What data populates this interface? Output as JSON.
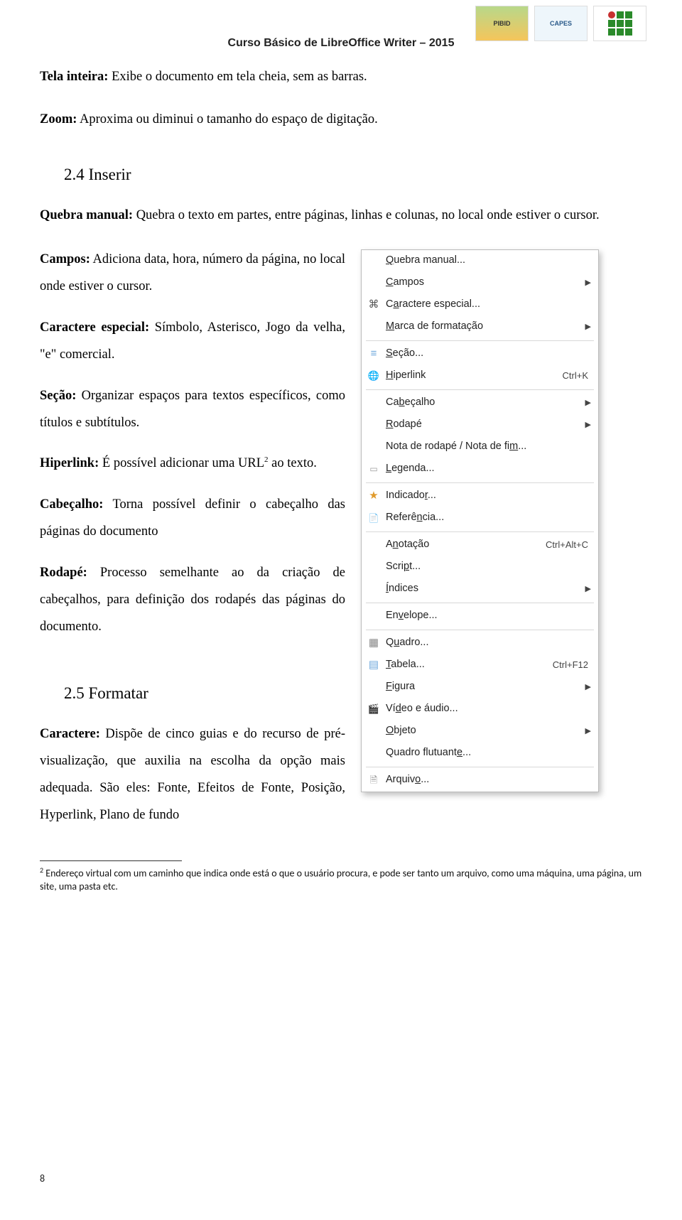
{
  "header": {
    "course_title": "Curso Básico de LibreOffice Writer – 2015",
    "logos": {
      "pibid": "PIBID",
      "capes": "CAPES",
      "if": "IFRN"
    }
  },
  "body": {
    "tela_label": "Tela inteira:",
    "tela_text": " Exibe o documento em tela cheia, sem as barras.",
    "zoom_label": "Zoom:",
    "zoom_text": " Aproxima ou diminui o tamanho do espaço de digitação.",
    "sec24_heading": "2.4 Inserir",
    "quebra_label": "Quebra manual:",
    "quebra_text_1": " Quebra o texto em partes, entre páginas, linhas e colunas, no local onde estiver o cursor.",
    "campos_label": "Campos:",
    "campos_text": " Adiciona data, hora, número da página, no local onde estiver o cursor.",
    "caractere_esp_label": "Caractere especial:",
    "caractere_esp_text": " Símbolo, Asterisco, Jogo da velha, \"e\" comercial.",
    "secao_label": "Seção:",
    "secao_text": " Organizar espaços para textos específicos, como títulos e subtítulos.",
    "hiperlink_label": "Hiperlink:",
    "hiperlink_text_pre": " É possível adicionar uma URL",
    "hiperlink_sup": "2",
    "hiperlink_text_post": " ao texto.",
    "cabecalho_label": "Cabeçalho:",
    "cabecalho_text": " Torna possível definir o cabeçalho das páginas do documento",
    "rodape_label": "Rodapé:",
    "rodape_text": " Processo semelhante ao da criação de cabeçalhos, para definição dos rodapés das páginas do documento.",
    "sec25_heading": "2.5 Formatar",
    "caractere_label": "Caractere:",
    "caractere_text": " Dispõe de cinco guias e do recurso de pré-visualização, que auxilia na escolha da opção mais adequada. São eles: Fonte, Efeitos de Fonte, Posição, Hyperlink, Plano de fundo"
  },
  "menu": {
    "items": [
      {
        "icon": "",
        "pre": "",
        "u": "Q",
        "post": "uebra manual...",
        "sc": "",
        "arr": false
      },
      {
        "icon": "",
        "pre": "",
        "u": "C",
        "post": "ampos",
        "sc": "",
        "arr": true
      },
      {
        "icon": "hash",
        "pre": "C",
        "u": "a",
        "post": "ractere especial...",
        "sc": "",
        "arr": false
      },
      {
        "icon": "",
        "pre": "",
        "u": "M",
        "post": "arca de formatação",
        "sc": "",
        "arr": true
      },
      {
        "sep": true
      },
      {
        "icon": "section",
        "pre": "",
        "u": "S",
        "post": "eção...",
        "sc": "",
        "arr": false
      },
      {
        "icon": "hlink",
        "pre": "",
        "u": "H",
        "post": "iperlink",
        "sc": "Ctrl+K",
        "arr": false
      },
      {
        "sep": true
      },
      {
        "icon": "",
        "pre": "Ca",
        "u": "b",
        "post": "eçalho",
        "sc": "",
        "arr": true
      },
      {
        "icon": "",
        "pre": "",
        "u": "R",
        "post": "odapé",
        "sc": "",
        "arr": true
      },
      {
        "icon": "",
        "pre": "Nota de rodapé / Nota de fi",
        "u": "m",
        "post": "...",
        "sc": "",
        "arr": false
      },
      {
        "icon": "legend",
        "pre": "",
        "u": "L",
        "post": "egenda...",
        "sc": "",
        "arr": false
      },
      {
        "sep": true
      },
      {
        "icon": "star",
        "pre": "Indicado",
        "u": "r",
        "post": "...",
        "sc": "",
        "arr": false
      },
      {
        "icon": "ref",
        "pre": "Referê",
        "u": "n",
        "post": "cia...",
        "sc": "",
        "arr": false
      },
      {
        "sep": true
      },
      {
        "icon": "",
        "pre": "A",
        "u": "n",
        "post": "otação",
        "sc": "Ctrl+Alt+C",
        "arr": false
      },
      {
        "icon": "",
        "pre": "Scri",
        "u": "p",
        "post": "t...",
        "sc": "",
        "arr": false
      },
      {
        "icon": "",
        "pre": "",
        "u": "Í",
        "post": "ndices",
        "sc": "",
        "arr": true
      },
      {
        "sep": true
      },
      {
        "icon": "",
        "pre": "En",
        "u": "v",
        "post": "elope...",
        "sc": "",
        "arr": false
      },
      {
        "sep": true
      },
      {
        "icon": "frame",
        "pre": "Q",
        "u": "u",
        "post": "adro...",
        "sc": "",
        "arr": false
      },
      {
        "icon": "table",
        "pre": "",
        "u": "T",
        "post": "abela...",
        "sc": "Ctrl+F12",
        "arr": false
      },
      {
        "icon": "",
        "pre": "",
        "u": "F",
        "post": "igura",
        "sc": "",
        "arr": true
      },
      {
        "icon": "video",
        "pre": "Ví",
        "u": "d",
        "post": "eo e áudio...",
        "sc": "",
        "arr": false
      },
      {
        "icon": "",
        "pre": "",
        "u": "O",
        "post": "bjeto",
        "sc": "",
        "arr": true
      },
      {
        "icon": "",
        "pre": "Quadro flutuant",
        "u": "e",
        "post": "...",
        "sc": "",
        "arr": false
      },
      {
        "sep": true
      },
      {
        "icon": "file",
        "pre": "Arquiv",
        "u": "o",
        "post": "...",
        "sc": "",
        "arr": false
      }
    ]
  },
  "footnote": {
    "num": "2",
    "text": " Endereço virtual com um caminho que indica onde está o que o usuário procura, e pode ser tanto um arquivo, como uma máquina, uma página, um site, uma pasta etc."
  },
  "pagenum": "8"
}
